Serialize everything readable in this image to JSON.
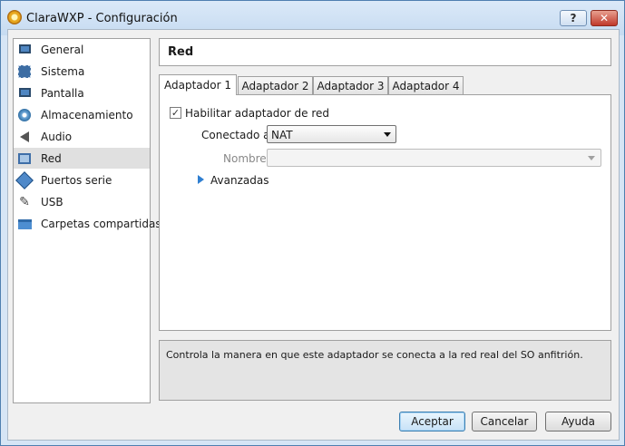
{
  "window": {
    "title": "ClaraWXP - Configuración",
    "help_label": "?",
    "close_label": "✕"
  },
  "sidebar": {
    "items": [
      {
        "label": "General",
        "icon": "monitor-icon"
      },
      {
        "label": "Sistema",
        "icon": "chip-icon"
      },
      {
        "label": "Pantalla",
        "icon": "display-icon"
      },
      {
        "label": "Almacenamiento",
        "icon": "disk-icon"
      },
      {
        "label": "Audio",
        "icon": "speaker-icon"
      },
      {
        "label": "Red",
        "icon": "network-icon",
        "selected": true
      },
      {
        "label": "Puertos serie",
        "icon": "serial-port-icon"
      },
      {
        "label": "USB",
        "icon": "usb-icon"
      },
      {
        "label": "Carpetas compartidas",
        "icon": "folder-icon"
      }
    ]
  },
  "page": {
    "title": "Red"
  },
  "tabs": [
    {
      "label": "Adaptador 1",
      "active": true
    },
    {
      "label": "Adaptador 2"
    },
    {
      "label": "Adaptador 3"
    },
    {
      "label": "Adaptador 4"
    }
  ],
  "adapter": {
    "enable_label": "Habilitar adaptador de red",
    "enabled": true,
    "attached_label": "Conectado a:",
    "attached_value": "NAT",
    "name_label": "Nombre:",
    "name_value": "",
    "advanced_label": "Avanzadas"
  },
  "description": "Controla la manera en que este adaptador se conecta a la red real del SO anfitrión.",
  "buttons": {
    "accept": "Aceptar",
    "cancel": "Cancelar",
    "help": "Ayuda"
  }
}
